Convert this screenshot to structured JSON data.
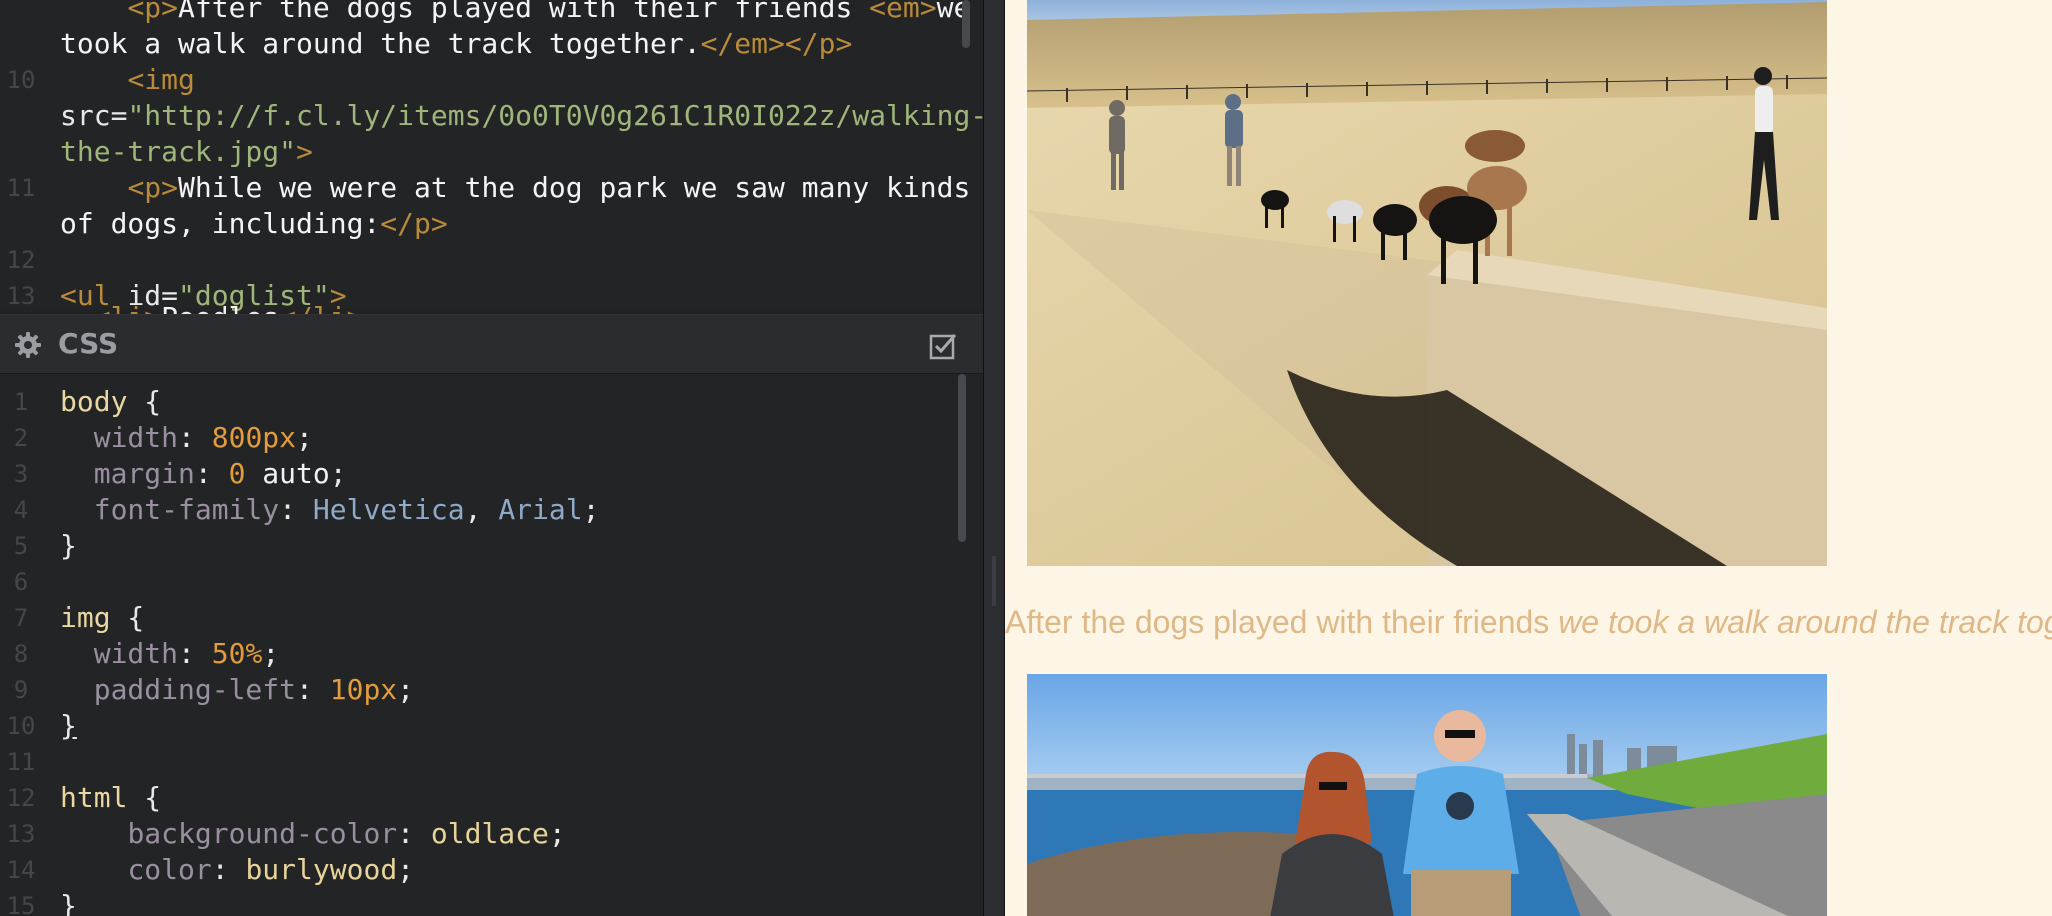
{
  "html_editor": {
    "lines": [
      {
        "num": "",
        "tag_a": "<p>",
        "text_a": "After the dogs played with their friends ",
        "tag_b": "<em>",
        "text_b": "we"
      },
      {
        "num": "",
        "text_a": "took a walk around the track together.",
        "tag_a": "</em></p>"
      },
      {
        "num": "10",
        "tag_a": "<img"
      },
      {
        "num": "",
        "attr": "src",
        "eq": "=",
        "str": "\"http://f.cl.ly/items/0o0T0V0g261C1R0I022z/walking-"
      },
      {
        "num": "",
        "str": "the-track.jpg\"",
        "tag_a": ">"
      },
      {
        "num": "11",
        "tag_a": "<p>",
        "text_a": "While we were at the dog park we saw many kinds"
      },
      {
        "num": "",
        "text_a": "of dogs, including:",
        "tag_a": "</p>"
      },
      {
        "num": "12"
      },
      {
        "num": "13",
        "tag_a": "<ul ",
        "attr": "id",
        "eq": "=",
        "str": "\"doglist\"",
        "tag_b": ">"
      },
      {
        "num": "",
        "tag_a": "<li>",
        "text_a": "Poodles",
        "tag_b": "</li>"
      }
    ]
  },
  "css_pane": {
    "title": "CSS",
    "gear_icon": "gear-icon",
    "toggle_icon": "checkbox-icon",
    "lines": [
      {
        "num": "1",
        "sel": "body",
        "punc": " {"
      },
      {
        "num": "2",
        "prop": "width",
        "punc": ": ",
        "val": "800px",
        "end": ";"
      },
      {
        "num": "3",
        "prop": "margin",
        "punc": ": ",
        "val": "0",
        "val2": " auto",
        "end": ";"
      },
      {
        "num": "4",
        "prop": "font-family",
        "punc": ": ",
        "val": "Helvetica",
        "sep": ", ",
        "val2": "Arial",
        "end": ";"
      },
      {
        "num": "5",
        "punc": "}"
      },
      {
        "num": "6"
      },
      {
        "num": "7",
        "sel": "img",
        "punc": " {"
      },
      {
        "num": "8",
        "prop": "width",
        "punc": ": ",
        "val": "50%",
        "end": ";"
      },
      {
        "num": "9",
        "prop": "padding-left",
        "punc": ": ",
        "val": "10px",
        "end": ";"
      },
      {
        "num": "10",
        "punc": "}"
      },
      {
        "num": "11"
      },
      {
        "num": "12",
        "sel": "html",
        "punc": " {"
      },
      {
        "num": "13",
        "prop": "background-color",
        "punc": ": ",
        "val": "oldlace",
        "end": ";"
      },
      {
        "num": "14",
        "prop": "color",
        "punc": ": ",
        "val": "burlywood",
        "end": ";"
      },
      {
        "num": "15",
        "punc": "}"
      }
    ]
  },
  "preview": {
    "caption_plain": "After the dogs played with their friends ",
    "caption_em": "we took a walk around the track tog",
    "background": "#fdf5e6",
    "text_color": "#deb887"
  }
}
